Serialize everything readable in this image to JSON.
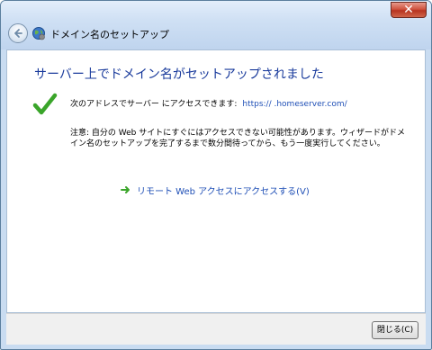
{
  "window": {
    "title": "ドメイン名のセットアップ",
    "close_glyph": "✕"
  },
  "main": {
    "heading": "サーバー上でドメイン名がセットアップされました",
    "address_label": "次のアドレスでサーバー にアクセスできます:",
    "address_url": "https://          .homeserver.com/",
    "note": "注意: 自分の Web サイトにすぐにはアクセスできない可能性があります。ウィザードがドメイン名のセットアップを完了するまで数分間待ってから、もう一度実行してください。",
    "remote_link": "リモート Web アクセスにアクセスする(V)"
  },
  "footer": {
    "close_button": "閉じる(C)"
  },
  "icons": {
    "back": "back-arrow-icon",
    "globe": "globe-icon",
    "check": "checkmark-icon",
    "link_arrow": "green-arrow-icon"
  },
  "colors": {
    "heading": "#1a3b9c",
    "link": "#1f4fb6",
    "check": "#3aa52a"
  }
}
